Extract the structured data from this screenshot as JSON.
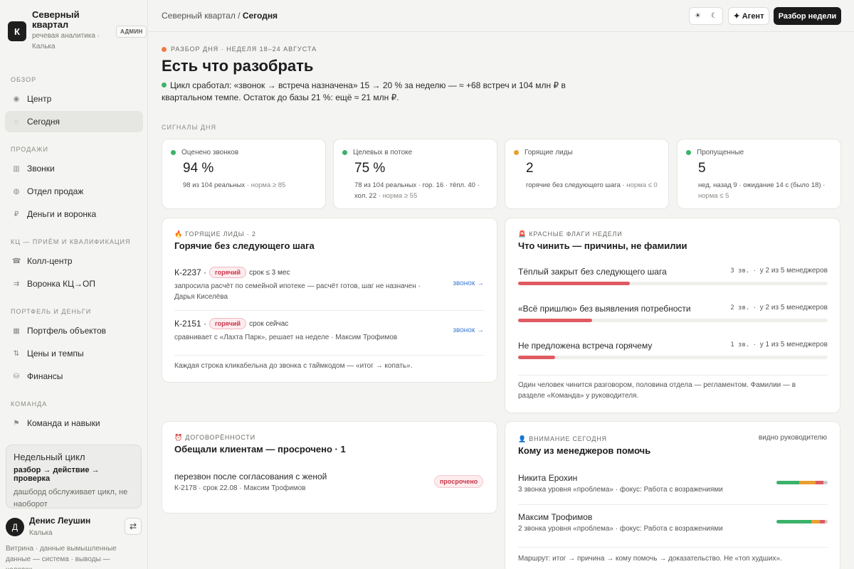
{
  "brand": {
    "logo_letter": "К",
    "name": "Северный квартал",
    "subtitle": "речевая аналитика · Калька",
    "badge": "АДМИН"
  },
  "nav": {
    "sections": [
      {
        "label": "ОБЗОР",
        "items": [
          {
            "label": "Центр",
            "icon": "target-icon",
            "glyph": "◉",
            "active": false
          },
          {
            "label": "Сегодня",
            "icon": "circle-icon",
            "glyph": "◌",
            "active": true
          }
        ]
      },
      {
        "label": "ПРОДАЖИ",
        "items": [
          {
            "label": "Звонки",
            "icon": "bars-icon",
            "glyph": "▥"
          },
          {
            "label": "Отдел продаж",
            "icon": "dot-icon",
            "glyph": "◍"
          },
          {
            "label": "Деньги и воронка",
            "icon": "ruble-icon",
            "glyph": "₽"
          }
        ]
      },
      {
        "label": "КЦ — ПРИЁМ И КВАЛИФИКАЦИЯ",
        "items": [
          {
            "label": "Колл-центр",
            "icon": "phone-icon",
            "glyph": "☎"
          },
          {
            "label": "Воронка КЦ→ОП",
            "icon": "flow-icon",
            "glyph": "⇉"
          }
        ]
      },
      {
        "label": "ПОРТФЕЛЬ И ДЕНЬГИ",
        "items": [
          {
            "label": "Портфель объектов",
            "icon": "grid-icon",
            "glyph": "▦"
          },
          {
            "label": "Цены и темпы",
            "icon": "sort-icon",
            "glyph": "⇅"
          },
          {
            "label": "Финансы",
            "icon": "coins-icon",
            "glyph": "⛁"
          }
        ]
      },
      {
        "label": "КОМАНДА",
        "items": [
          {
            "label": "Команда и навыки",
            "icon": "flag-icon",
            "glyph": "⚑"
          }
        ]
      }
    ]
  },
  "cycle": {
    "title": "Недельный цикл",
    "flow": "разбор → действие → проверка",
    "note": "дашборд обслуживает цикл, не наоборот"
  },
  "user": {
    "initial": "Д",
    "name": "Денис Леушин",
    "city": "Калька",
    "swap_glyph": "⇄"
  },
  "footer_note": "Витрина · данные вымышленные данные — система · выводы — человек",
  "topbar": {
    "crumb_root": "Северный квартал /",
    "crumb_current": "Сегодня",
    "theme_light": "☀",
    "theme_dark": "☾",
    "agent_label": "✦ Агент",
    "review_label": "Разбор недели"
  },
  "header": {
    "eyebrow": "РАЗБОР ДНЯ · НЕДЕЛЯ 18–24 АВГУСТА",
    "eyebrow_color": "#f07a45",
    "title": "Есть что разобрать",
    "summary": "Цикл сработал: «звонок → встреча назначена» 15 → 20 % за неделю — ≈ +68 встреч и 104 млн ₽ в квартальном темпе. Остаток до базы 21 %: ещё ≈ 21 млн ₽.",
    "summary_dot_color": "#3bb26a",
    "signals_label": "СИГНАЛЫ ДНЯ"
  },
  "signals": [
    {
      "label": "Оценено звонков",
      "value": "94  %",
      "desc": "98 из 104 реальных ·",
      "norm": "норма ≥ 85",
      "color": "#3bb26a"
    },
    {
      "label": "Целевых в потоке",
      "value": "75  %",
      "desc": "78 из 104 реальных · гор. 16 · тёпл. 40 · хол. 22 ·",
      "norm": "норма ≥ 55",
      "color": "#3bb26a"
    },
    {
      "label": "Горящие лиды",
      "value": "2",
      "desc": "горячие без следующего шага ·",
      "norm": "норма ≤ 0",
      "color": "#e8a030"
    },
    {
      "label": "Пропущенные",
      "value": "5",
      "desc": "нед. назад 9 · ожидание 14 с (было 18) ·",
      "norm": "норма ≤ 5",
      "color": "#3bb26a"
    }
  ],
  "hot_leads": {
    "eyebrow": "🔥 ГОРЯЩИЕ ЛИДЫ · 2",
    "title": "Горячие без следующего шага",
    "items": [
      {
        "id": "К-2237 ·",
        "tag": "горячий",
        "term": "срок ≤ 3 мес",
        "desc": "запросила расчёт по семейной ипотеке — расчёт готов, шаг не назначен · Дарья Киселёва",
        "link": "звонок →"
      },
      {
        "id": "К-2151 ·",
        "tag": "горячий",
        "term": "срок сейчас",
        "desc": "сравнивает с «Лахта Парк», решает на неделе · Максим Трофимов",
        "link": "звонок →"
      }
    ],
    "footer": "Каждая строка кликабельна до звонка с таймкодом — «итог → копать»."
  },
  "red_flags": {
    "eyebrow": "🚨 КРАСНЫЕ ФЛАГИ НЕДЕЛИ",
    "title": "Что чинить — причины, не фамилии",
    "items": [
      {
        "label": "Тёплый закрыт без следующего шага",
        "count": "3 зв.",
        "scope": "у 2 из 5 менеджеров",
        "share": 0.36
      },
      {
        "label": "«Всё пришлю» без выявления потребности",
        "count": "2 зв.",
        "scope": "у 2 из 5 менеджеров",
        "share": 0.24
      },
      {
        "label": "Не предложена встреча горячему",
        "count": "1 зв.",
        "scope": "у 1 из 5 менеджеров",
        "share": 0.12
      }
    ],
    "footer": "Один человек чинится разговором, половина отдела — регламентом. Фамилии — в разделе «Команда» у руководителя."
  },
  "promises": {
    "eyebrow": "⏰ ДОГОВОРЁННОСТИ",
    "title": "Обещали клиентам — просрочено · 1",
    "item_text": "перезвон после согласования с женой",
    "item_sub": "К-2178 · срок 22.08 · Максим Трофимов",
    "tag": "просрочено"
  },
  "attention": {
    "eyebrow": "👤 ВНИМАНИЕ СЕГОДНЯ",
    "visible_to": "видно руководителю",
    "title": "Кому из менеджеров помочь",
    "items": [
      {
        "name": "Никита Ерохин",
        "sub": "3 звонка уровня «проблема» · фокус: Работа с возражениями",
        "bar": [
          {
            "share": 0.44,
            "color": "#3bb26a"
          },
          {
            "share": 0.33,
            "color": "#e8a030"
          },
          {
            "share": 0.14,
            "color": "#e05a62"
          },
          {
            "share": 0.09,
            "color": "#c9c9c5"
          }
        ]
      },
      {
        "name": "Максим Трофимов",
        "sub": "2 звонка уровня «проблема» · фокус: Работа с возражениями",
        "bar": [
          {
            "share": 0.68,
            "color": "#3bb26a"
          },
          {
            "share": 0.17,
            "color": "#e8a030"
          },
          {
            "share": 0.1,
            "color": "#e05a62"
          },
          {
            "share": 0.05,
            "color": "#c9c9c5"
          }
        ]
      }
    ],
    "footer": "Маршрут: итог → причина → кому помочь → доказательство. Не «топ худших»."
  }
}
